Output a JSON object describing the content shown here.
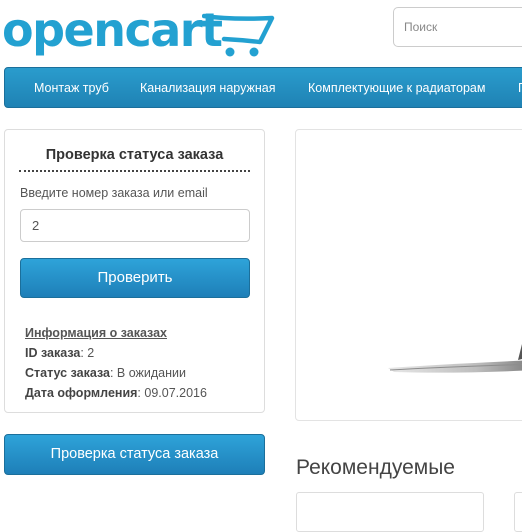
{
  "logo": {
    "text": "opencart"
  },
  "search": {
    "placeholder": "Поиск"
  },
  "nav": {
    "items": [
      "Монтаж труб",
      "Канализация наружная",
      "Комплектующие к радиаторам",
      "П"
    ]
  },
  "order_status": {
    "title": "Проверка статуса заказа",
    "input_label": "Введите номер заказа или email",
    "input_value": "2",
    "submit_label": "Проверить",
    "info_heading": "Информация о заказах",
    "id_label": "ID заказа",
    "id_value": ": 2",
    "status_label": "Статус заказа",
    "status_value": ": В ожидании",
    "date_label": "Дата оформления",
    "date_value": ": 09.07.2016"
  },
  "sidebar_button": {
    "label": "Проверка статуса заказа"
  },
  "featured": {
    "title": "Рекомендуемые"
  },
  "colors": {
    "brand": "#23a1d1",
    "nav_bg": "#2a9ccd",
    "button_bg": "#1e7fb8"
  }
}
